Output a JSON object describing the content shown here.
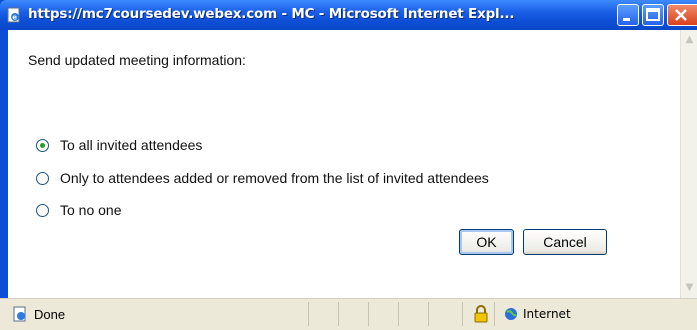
{
  "window": {
    "title": "https://mc7coursedev.webex.com - MC - Microsoft Internet Expl...",
    "icons": {
      "title": "ie-page-icon",
      "minimize": "minimize-icon",
      "maximize": "maximize-icon",
      "close": "close-icon"
    }
  },
  "dialog": {
    "heading": "Send updated meeting information:",
    "options": [
      {
        "label": "To all invited attendees",
        "selected": true
      },
      {
        "label": "Only to attendees added or removed from the list of invited attendees",
        "selected": false
      },
      {
        "label": "To no one",
        "selected": false
      }
    ],
    "ok_label": "OK",
    "cancel_label": "Cancel"
  },
  "statusbar": {
    "status_text": "Done",
    "zone_text": "Internet",
    "icons": {
      "page": "page-done-icon",
      "lock": "lock-icon",
      "zone": "internet-zone-icon"
    }
  },
  "colors": {
    "titlebar": "#0b4dd6",
    "radio_dot": "#21a121",
    "close_button": "#d9411c"
  }
}
